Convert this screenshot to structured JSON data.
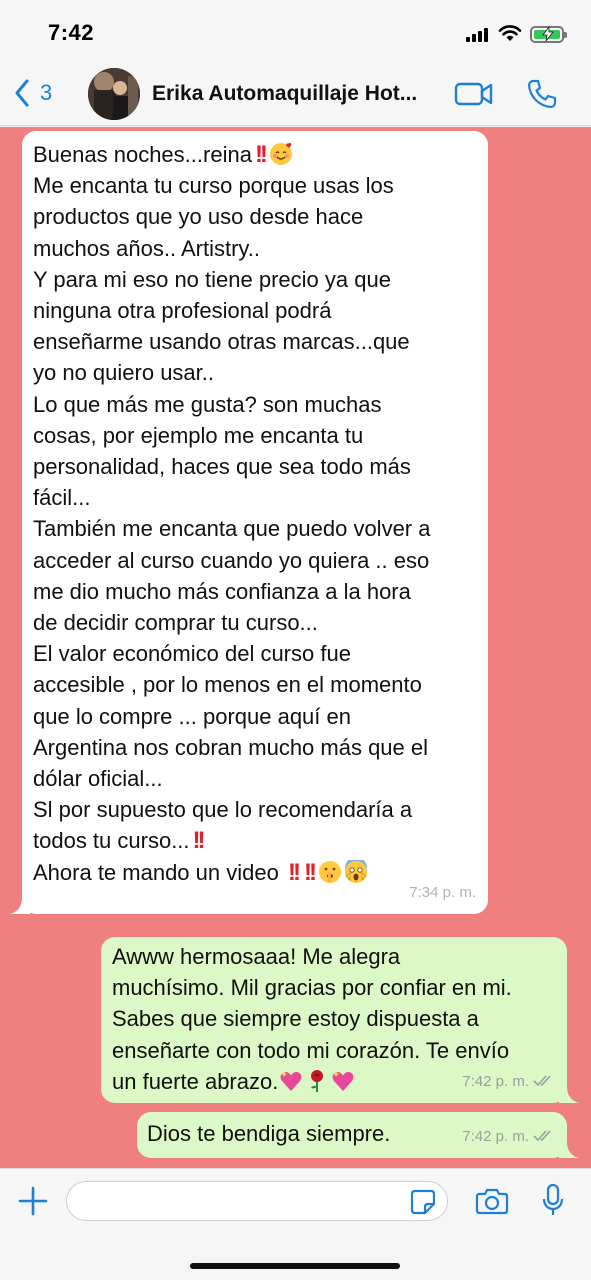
{
  "status_bar": {
    "time": "7:42"
  },
  "header": {
    "back_count": "3",
    "contact_name": "Erika Automaquillaje Hot...",
    "accent_color": "#1d7fd8"
  },
  "chat": {
    "background_color": "#f08080",
    "incoming": {
      "lines": [
        "Buenas noches...reina",
        "Me encanta tu curso porque usas los",
        "productos que yo uso desde hace",
        "muchos años.. Artistry..",
        "Y para mi  eso no tiene precio ya que",
        "ninguna otra profesional podrá",
        "enseñarme usando otras marcas...que",
        "yo no quiero usar..",
        "Lo que más me gusta? son muchas",
        "cosas, por ejemplo me encanta tu",
        "personalidad,  haces que sea todo más",
        "fácil...",
        "También me encanta que puedo volver a",
        "acceder al curso cuando yo quiera .. eso",
        "me dio mucho más confianza a la hora",
        "de decidir comprar tu curso...",
        "El valor económico del curso    fue",
        "accesible , por lo menos en el momento",
        "que lo compre ... porque  aquí en",
        "Argentina nos cobran mucho más que el",
        "dólar oficial...",
        "Sl por supuesto que lo recomendaría a",
        "todos tu curso...",
        "Ahora te mando un video"
      ],
      "emoji_line1": [
        "double-exclamation",
        "smiling-face-with-hearts"
      ],
      "emoji_line23": [
        "double-exclamation"
      ],
      "emoji_line24": [
        "double-exclamation",
        "double-exclamation",
        "shushing-face",
        "screaming-face"
      ],
      "time": "7:34 p. m."
    },
    "outgoing": [
      {
        "lines": [
          "Awww hermosaaa! Me alegra",
          "muchísimo. Mil gracias por confiar en mi.",
          "Sabes que siempre estoy dispuesta a",
          "enseñarte con todo mi corazón. Te envío",
          "un fuerte abrazo."
        ],
        "emojis": [
          "sparkling-heart",
          "rose",
          "sparkling-heart"
        ],
        "time": "7:42 p. m.",
        "status": "read"
      },
      {
        "lines": [
          "Dios te bendiga siempre."
        ],
        "time": "7:42 p. m.",
        "status": "read"
      }
    ]
  },
  "input_bar": {
    "placeholder": "",
    "value": ""
  }
}
